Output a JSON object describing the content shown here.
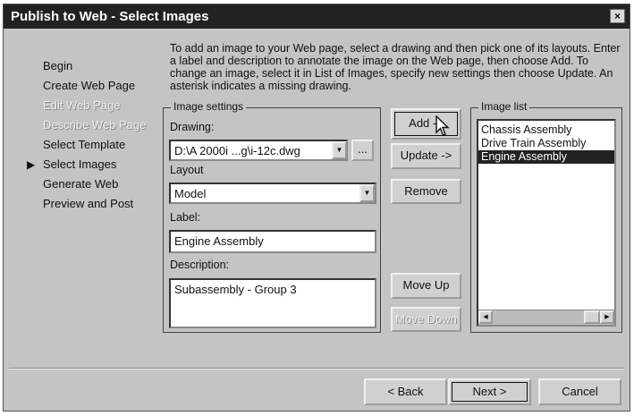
{
  "window": {
    "title": "Publish to Web - Select Images",
    "close_label": "×"
  },
  "nav": {
    "items": [
      {
        "label": "Begin",
        "enabled": true
      },
      {
        "label": "Create Web Page",
        "enabled": true
      },
      {
        "label": "Edit  Web Page",
        "enabled": false
      },
      {
        "label": "Describe Web Page",
        "enabled": false
      },
      {
        "label": "Select Template",
        "enabled": true
      },
      {
        "label": "Select Images",
        "enabled": true,
        "current": true
      },
      {
        "label": "Generate Web",
        "enabled": true
      },
      {
        "label": "Preview  and Post",
        "enabled": true
      }
    ],
    "current_marker": "▶"
  },
  "instructions": "To add an image to your Web page, select a drawing and then pick one of its layouts. Enter a label and description to annotate the image on the Web page, then choose Add. To change an image, select it in List of Images, specify new settings then choose Update. An asterisk indicates a missing drawing.",
  "image_settings": {
    "title": "Image settings",
    "drawing_label": "Drawing:",
    "drawing_value": "D:\\A 2000i ...g\\i-12c.dwg",
    "browse_label": "...",
    "layout_label": "Layout",
    "layout_value": "Model",
    "label_label": "Label:",
    "label_value": "Engine Assembly",
    "description_label": "Description:",
    "description_value": "Subassembly - Group 3"
  },
  "actions": {
    "add": "Add ->",
    "update": "Update ->",
    "remove": "Remove",
    "move_up": "Move Up",
    "move_down": "Move Down"
  },
  "image_list": {
    "title": "Image list",
    "items": [
      "Chassis Assembly",
      "Drive Train Assembly",
      "Engine Assembly"
    ],
    "selected_index": 2
  },
  "footer": {
    "back": "< Back",
    "next": "Next >",
    "cancel": "Cancel"
  },
  "icons": {
    "dropdown": "triangle-down",
    "scroll_left": "triangle-left",
    "scroll_right": "triangle-right",
    "pointer": "mouse-cursor"
  }
}
